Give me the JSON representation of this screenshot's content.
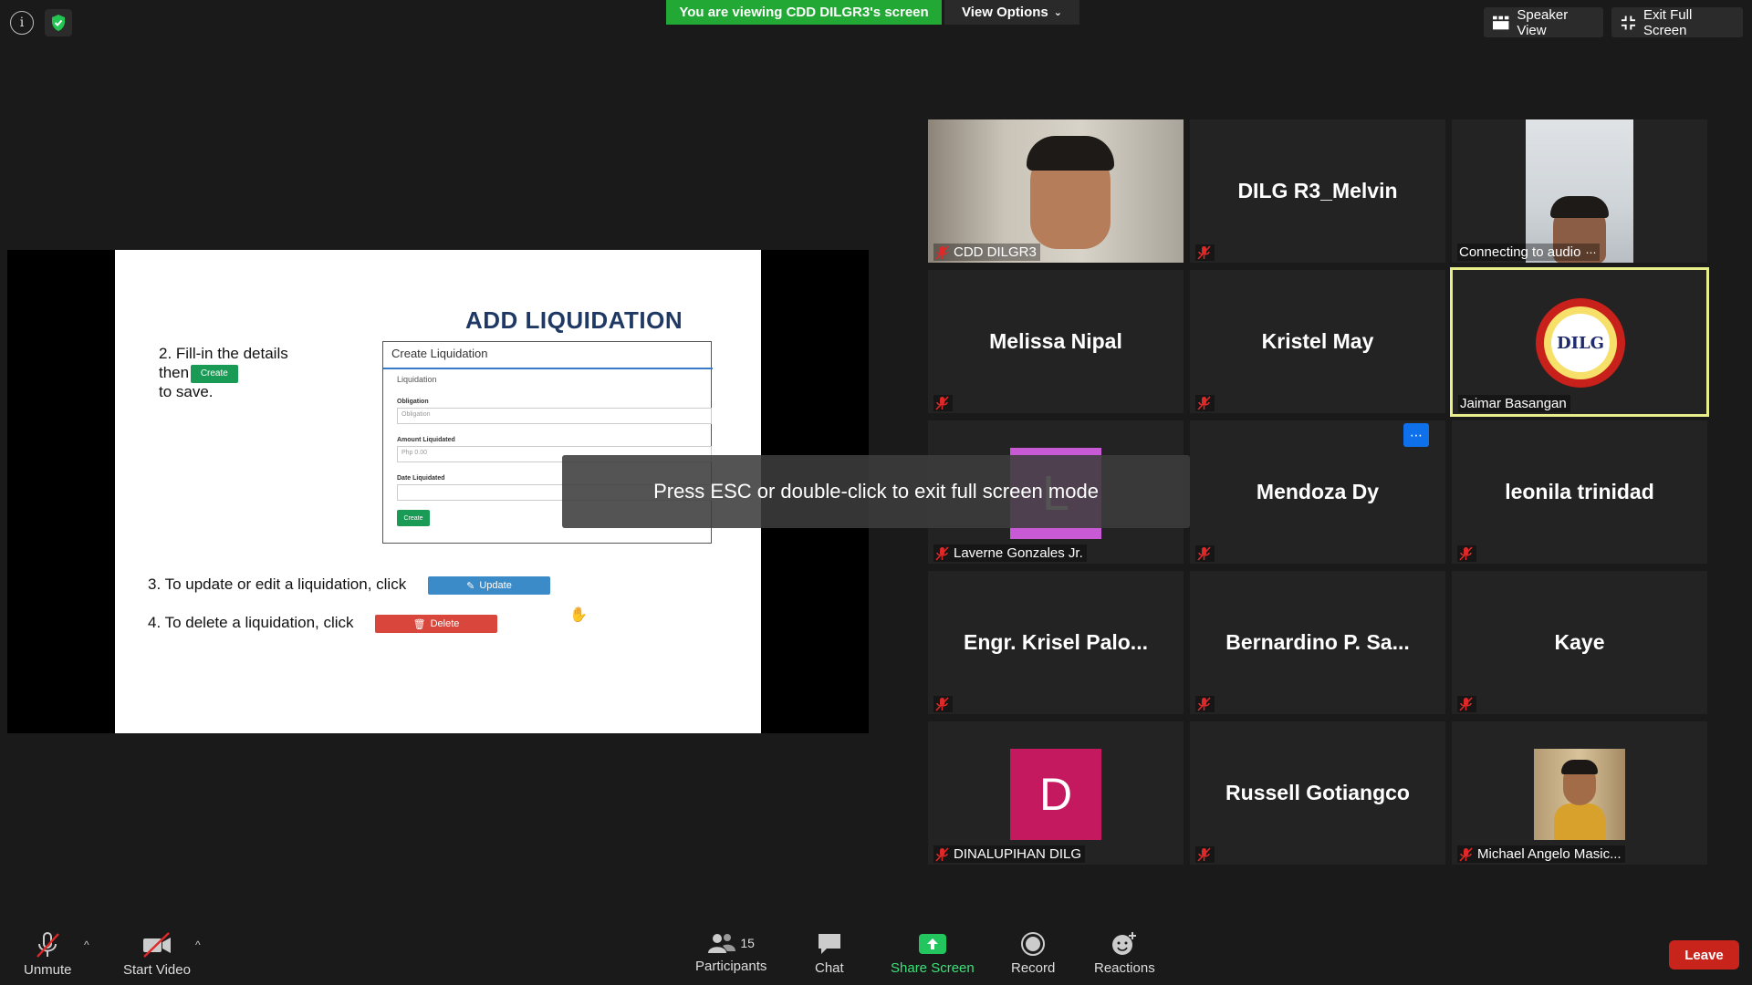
{
  "banner": {
    "viewing_text": "You are viewing CDD DILGR3's screen",
    "view_options_label": "View Options"
  },
  "top_right": {
    "speaker_view_label": "Speaker View",
    "exit_full_screen_label": "Exit Full Screen"
  },
  "slide": {
    "title": "ADD LIQUIDATION",
    "step2_line1": "2. Fill-in the details",
    "step2_line2": "then",
    "step2_line3": "to save.",
    "create_btn": "Create",
    "step3": "3. To update or edit a liquidation, click",
    "update_btn": "Update",
    "step4": "4. To delete a liquidation, click",
    "delete_btn": "Delete",
    "form": {
      "title": "Create Liquidation",
      "section": "Liquidation",
      "obligation_label": "Obligation",
      "obligation_placeholder": "Obligation",
      "amount_label": "Amount Liquidated",
      "amount_placeholder": "Php 0.00",
      "date_label": "Date Liquidated",
      "create_btn": "Create"
    }
  },
  "esc_toast": "Press ESC or double-click to exit full screen mode",
  "participants": [
    {
      "display_name": "",
      "label": "CDD DILGR3"
    },
    {
      "display_name": "DILG R3_Melvin",
      "label": ""
    },
    {
      "display_name": "",
      "label": "Connecting to audio"
    },
    {
      "display_name": "Melissa Nipal",
      "label": ""
    },
    {
      "display_name": "Kristel May",
      "label": ""
    },
    {
      "display_name": "",
      "label": "Jaimar Basangan",
      "logo_text": "DILG"
    },
    {
      "display_name": "",
      "label": "Laverne Gonzales Jr.",
      "avatar_letter": "L"
    },
    {
      "display_name": "Mendoza Dy",
      "label": ""
    },
    {
      "display_name": "leonila trinidad",
      "label": ""
    },
    {
      "display_name": "Engr. Krisel Palo...",
      "label": ""
    },
    {
      "display_name": "Bernardino P. Sa...",
      "label": ""
    },
    {
      "display_name": "Kaye",
      "label": ""
    },
    {
      "display_name": "",
      "label": "DINALUPIHAN DILG",
      "avatar_letter": "D"
    },
    {
      "display_name": "Russell Gotiangco",
      "label": ""
    },
    {
      "display_name": "",
      "label": "Michael Angelo Masic..."
    }
  ],
  "toolbar": {
    "unmute": "Unmute",
    "start_video": "Start Video",
    "participants": "Participants",
    "participants_count": "15",
    "chat": "Chat",
    "share_screen": "Share Screen",
    "record": "Record",
    "reactions": "Reactions",
    "leave": "Leave"
  },
  "colors": {
    "banner_green": "#21a835",
    "leave_red": "#c8241c",
    "active_speaker_border": "#e8ee8a",
    "create_green": "#1a9b55",
    "update_blue": "#3a8bc8",
    "delete_red": "#d9473c"
  }
}
